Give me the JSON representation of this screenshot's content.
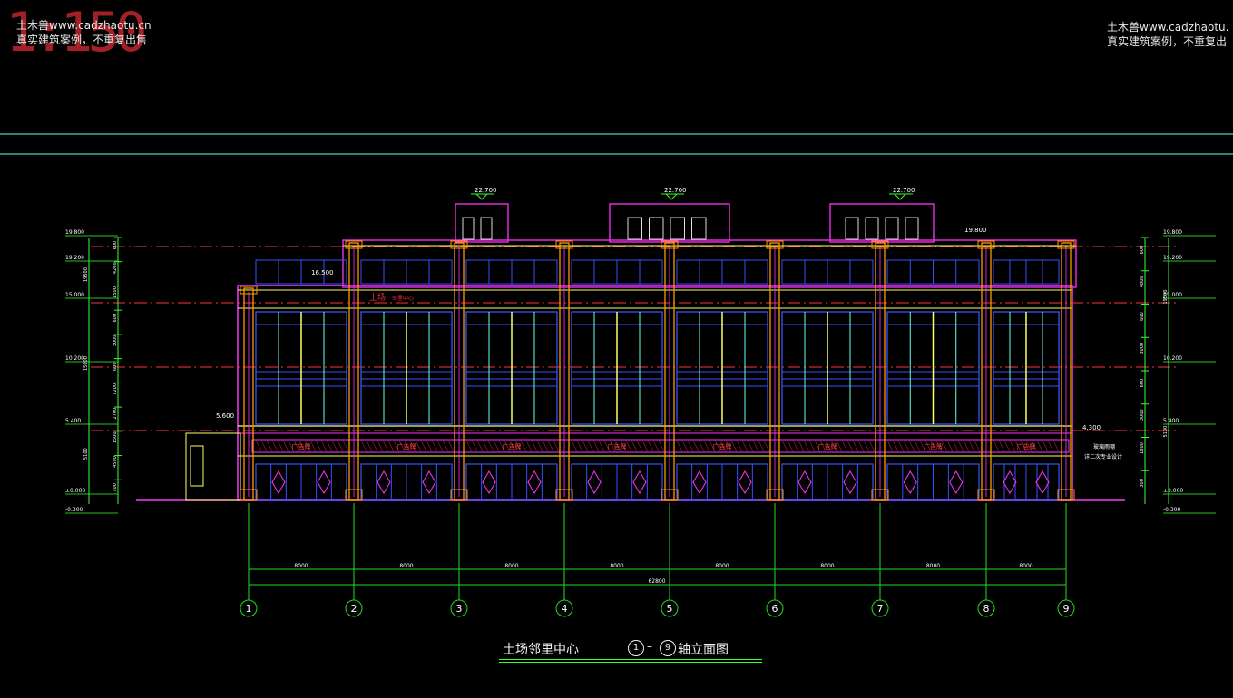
{
  "watermark_left": {
    "line1": "土木兽www.cadzhaotu.cn",
    "line2": "真实建筑案例，不重复出售"
  },
  "watermark_right": {
    "line1": "土木兽www.cadzhaotu.",
    "line2": "真实建筑案例，不重复出"
  },
  "scale_mark": "1:150",
  "drawing": {
    "project_name": "土场邻里中心",
    "view_title": "轴立面图",
    "axis_from": "1",
    "axis_to": "9",
    "dash": "–"
  },
  "axes": {
    "labels": [
      "1",
      "2",
      "3",
      "4",
      "5",
      "6",
      "7",
      "8",
      "9"
    ],
    "spans": [
      "8000",
      "8000",
      "8000",
      "8000",
      "8000",
      "8000",
      "8000",
      "8000"
    ],
    "total": "62800"
  },
  "roof_elevations": [
    "22.700",
    "22.700",
    "22.700"
  ],
  "roof_top_right": "19.800",
  "parapet_left": "16.500",
  "canopy_left": "5.600",
  "canopy_right": "4.300",
  "shop_signs": [
    "广告牌",
    "广告牌",
    "广告牌",
    "广告牌",
    "广告牌",
    "广告牌",
    "广告牌",
    "广告牌"
  ],
  "top_sign": "土场",
  "top_sign_sub": "邻里中心",
  "left_levels": [
    "19.800",
    "19.200",
    "15.000",
    "10.200",
    "5.400",
    "±0.000",
    "-0.300"
  ],
  "left_dims_inner": [
    "600",
    "4200",
    "1500",
    "600",
    "3000",
    "600",
    "1200",
    "2700",
    "1500",
    "4500",
    "100"
  ],
  "left_dims_outer": [
    "19500",
    "15000",
    "5100"
  ],
  "right_levels": [
    "19.800",
    "19.200",
    "15.000",
    "10.200",
    "5.400",
    "±0.000",
    "-0.300"
  ],
  "right_dims_inner": [
    "600",
    "4800",
    "600",
    "3000",
    "600",
    "3000",
    "1800",
    "300"
  ],
  "right_dims_outer": [
    "19500",
    "5100"
  ],
  "right_note_1": "玻璃雨棚",
  "right_note_2": "详二次专业设计",
  "colors": {
    "bg": "#000000",
    "axis": "#22dd22",
    "column": "#ff9900",
    "facade": "#ff33ff",
    "glass": "#3355ff",
    "frame": "#ffff66",
    "level": "#ff3333",
    "guide": "#66ffee",
    "dim": "#33ff33"
  }
}
